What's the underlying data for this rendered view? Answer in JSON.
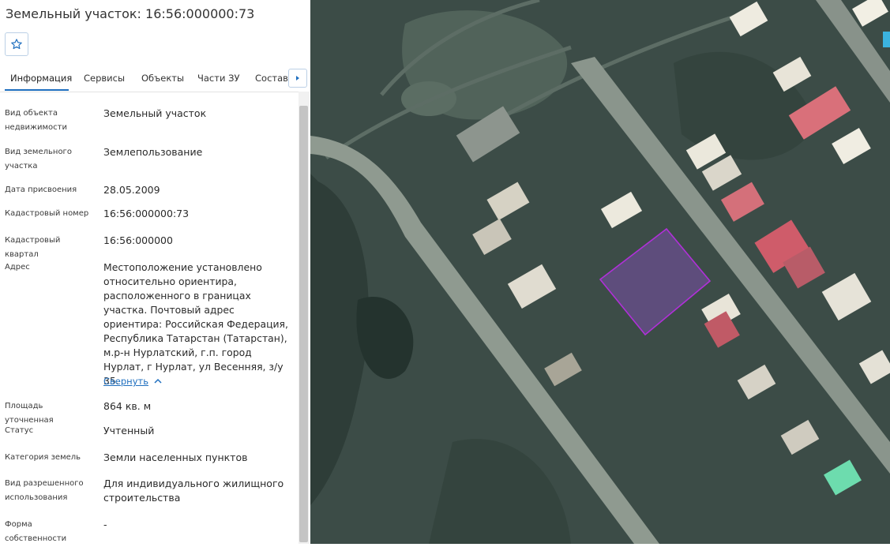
{
  "header": {
    "title": "Земельный участок: 16:56:000000:73"
  },
  "tabs": [
    {
      "label": "Информация",
      "active": true
    },
    {
      "label": "Сервисы",
      "active": false
    },
    {
      "label": "Объекты",
      "active": false
    },
    {
      "label": "Части ЗУ",
      "active": false
    },
    {
      "label": "Состав",
      "active": false
    }
  ],
  "info": {
    "object_type": {
      "label": "Вид объекта недвижимости",
      "value": "Земельный участок"
    },
    "parcel_type": {
      "label": "Вид земельного участка",
      "value": "Землепользование"
    },
    "assigned_date": {
      "label": "Дата присвоения",
      "value": "28.05.2009"
    },
    "cadastral_number": {
      "label": "Кадастровый номер",
      "value": "16:56:000000:73"
    },
    "cadastral_quarter": {
      "label": "Кадастровый квартал",
      "value": "16:56:000000"
    },
    "address": {
      "label": "Адрес",
      "value": "Местоположение установлено относительно ориентира, расположенного в границах участка. Почтовый адрес ориентира: Российская Федерация, Республика Татарстан (Татарстан), м.р-н Нурлатский, г.п. город Нурлат, г Нурлат, ул Весенняя, з/у 35.",
      "collapse_label": "Свернуть"
    },
    "area": {
      "label": "Площадь уточненная",
      "value": "864 кв. м"
    },
    "status": {
      "label": "Статус",
      "value": "Учтенный"
    },
    "land_category": {
      "label": "Категория земель",
      "value": "Земли населенных пунктов"
    },
    "permitted_use": {
      "label": "Вид разрешенного использования",
      "value": "Для индивидуального жилищного строительства"
    },
    "ownership": {
      "label": "Форма собственности",
      "value": "-"
    }
  },
  "icons": {
    "favorite": "star-outline-icon",
    "tabs_next": "caret-right-icon",
    "collapse": "chevron-up-icon"
  },
  "colors": {
    "accent": "#1f6fbf",
    "parcel_outline": "#b030d8",
    "parcel_fill": "#7a4fa8"
  }
}
